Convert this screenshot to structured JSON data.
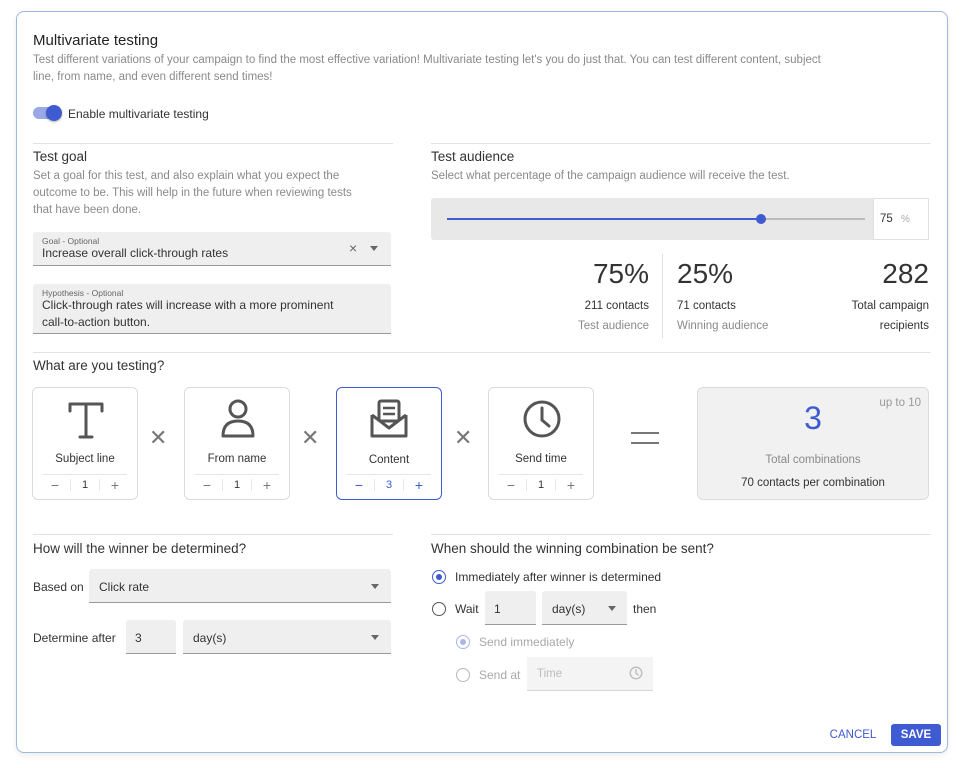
{
  "header": {
    "title": "Multivariate testing",
    "description_line1": "Test different variations of your campaign to find the most effective variation! Multivariate testing let's you do just that. You can test different content, subject",
    "description_line2": "line, from name, and even different send times!",
    "toggle_label": "Enable multivariate testing",
    "toggle_on": true
  },
  "test_goal": {
    "title": "Test goal",
    "desc_line1": "Set a goal for this test, and also explain what you expect the",
    "desc_line2": "outcome to be. This will help in the future when reviewing tests",
    "desc_line3": "that have been done.",
    "goal_label": "Goal - Optional",
    "goal_value": "Increase overall click-through rates",
    "hypothesis_label": "Hypothesis - Optional",
    "hypothesis_line1": "Click-through rates will increase with a more prominent",
    "hypothesis_line2": "call-to-action button."
  },
  "test_audience": {
    "title": "Test audience",
    "desc": "Select what percentage of the campaign audience will receive the test.",
    "slider_fraction": 0.75,
    "percent_value": "75",
    "percent_unit": "%",
    "test_pct": "75%",
    "test_contacts": "211 contacts",
    "test_label": "Test audience",
    "winning_pct": "25%",
    "winning_contacts": "71 contacts",
    "winning_label": "Winning audience",
    "total": "282",
    "total_label1": "Total campaign",
    "total_label2": "recipients"
  },
  "testing": {
    "title": "What are you testing?",
    "tiles": [
      {
        "label": "Subject line",
        "value": "1"
      },
      {
        "label": "From name",
        "value": "1"
      },
      {
        "label": "Content",
        "value": "3"
      },
      {
        "label": "Send time",
        "value": "1"
      }
    ],
    "total_value": "3",
    "up_to": "up to 10",
    "total_label": "Total combinations",
    "per_combination": "70 contacts per combination"
  },
  "winner": {
    "title": "How will the winner be determined?",
    "based_on_label": "Based on",
    "based_on_value": "Click rate",
    "determine_label": "Determine after",
    "determine_value": "3",
    "determine_unit": "day(s)"
  },
  "send": {
    "title": "When should the winning combination be sent?",
    "opt_immediately": "Immediately after winner is determined",
    "opt_wait": "Wait",
    "wait_value": "1",
    "wait_unit": "day(s)",
    "then": "then",
    "sub_immediately": "Send immediately",
    "sub_at": "Send at",
    "time_placeholder": "Time"
  },
  "actions": {
    "cancel": "CANCEL",
    "save": "SAVE"
  },
  "colors": {
    "accent": "#3f5bd1"
  }
}
